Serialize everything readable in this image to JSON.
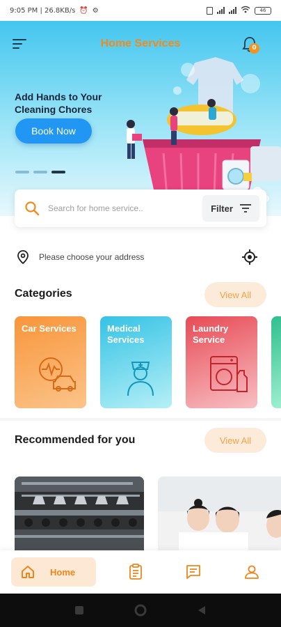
{
  "status_bar": {
    "time_speed": "9:05 PM | 26.8KB/s",
    "battery": "46"
  },
  "header": {
    "title": "Home Services",
    "notification_count": "0"
  },
  "hero": {
    "headline": "Add Hands to Your Cleaning Chores",
    "cta_label": "Book Now",
    "active_slide": 3,
    "slide_count": 3
  },
  "search": {
    "placeholder": "Search for home service..",
    "filter_label": "Filter"
  },
  "address": {
    "text": "Please choose your address"
  },
  "categories": {
    "title": "Categories",
    "view_all": "View All",
    "items": [
      {
        "label": "Car Services",
        "icon": "car-service-icon",
        "color_from": "#fbc48a",
        "color_to": "#f5963c"
      },
      {
        "label": "Medical Services",
        "icon": "nurse-icon",
        "color_from": "#4fd0ea",
        "color_to": "#a9eef5"
      },
      {
        "label": "Laundry Service",
        "icon": "washing-machine-icon",
        "color_from": "#e9565f",
        "color_to": "#f6b4b8"
      }
    ]
  },
  "recommended": {
    "title": "Recommended for you",
    "view_all": "View All"
  },
  "bottom_nav": {
    "home_label": "Home",
    "accent": "#f0851a"
  },
  "colors": {
    "brand_orange": "#f28a1c",
    "primary_blue": "#2196f3"
  }
}
